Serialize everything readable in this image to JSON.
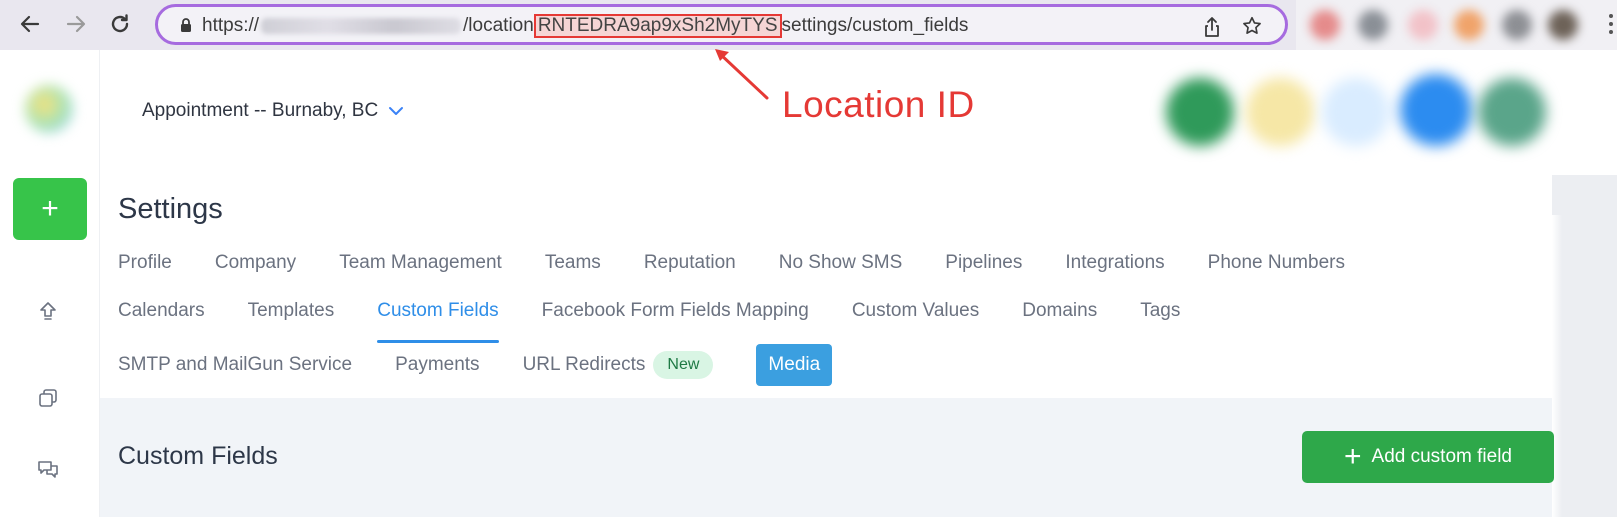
{
  "browser": {
    "url_prefix": "https://",
    "url_blurred_domain": "",
    "url_path_before": "/location",
    "url_highlight": "RNTEDRA9ap9xSh2MyTYS",
    "url_path_after": "settings/custom_fields",
    "icons": {
      "back": "arrow-left-icon",
      "forward": "arrow-right-icon",
      "reload": "reload-icon",
      "lock": "lock-icon",
      "share": "share-icon",
      "bookmark": "star-icon",
      "menu": "kebab-menu-icon"
    }
  },
  "annotation": {
    "label": "Location ID",
    "color": "#e53935"
  },
  "header": {
    "location_selector": "Appointment -- Burnaby, BC"
  },
  "sidebar": {
    "add_button": "+",
    "icons": [
      "upload-icon",
      "copy-icon",
      "chat-icon"
    ]
  },
  "settings": {
    "title": "Settings",
    "tabs_row1": [
      "Profile",
      "Company",
      "Team Management",
      "Teams",
      "Reputation",
      "No Show SMS",
      "Pipelines",
      "Integrations",
      "Phone Numbers"
    ],
    "tabs_row2": [
      "Calendars",
      "Templates",
      "Custom Fields",
      "Facebook Form Fields Mapping",
      "Custom Values",
      "Domains",
      "Tags"
    ],
    "tabs_row3": [
      "SMTP and MailGun Service",
      "Payments",
      "URL Redirects",
      "Media"
    ],
    "active_tab": "Custom Fields",
    "new_badge": "New"
  },
  "content": {
    "section_title": "Custom Fields",
    "add_button_label": "Add custom field"
  },
  "colors": {
    "accent_blue": "#2f8ee8",
    "primary_green": "#2ea84a",
    "sidebar_green": "#37c44a",
    "media_blue": "#3b9fe0",
    "omnibox_border": "#a66bdf"
  }
}
